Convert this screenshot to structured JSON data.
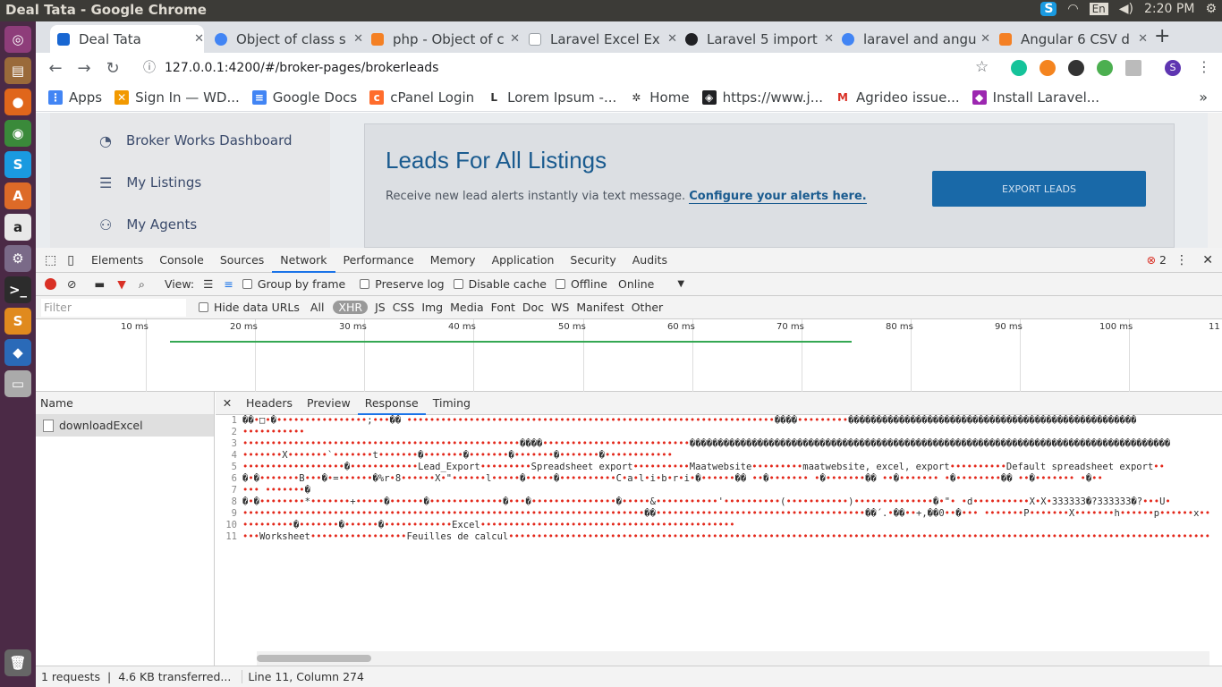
{
  "system": {
    "window_title": "Deal Tata - Google Chrome",
    "keyboard": "En",
    "time": "2:20 PM"
  },
  "tabs": [
    {
      "label": "Deal Tata",
      "color": "#1967d2"
    },
    {
      "label": "Object of class s",
      "color": "#4285f4"
    },
    {
      "label": "php - Object of c",
      "color": "#f48024"
    },
    {
      "label": "Laravel Excel Ex",
      "color": "#9aa0a6"
    },
    {
      "label": "Laravel 5 import",
      "color": "#202124"
    },
    {
      "label": "laravel and angu",
      "color": "#4285f4"
    },
    {
      "label": "Angular 6 CSV d",
      "color": "#f48024"
    }
  ],
  "address": {
    "url": "127.0.0.1:4200/#/broker-pages/brokerleads"
  },
  "bookmarks": [
    {
      "label": "Apps",
      "color": "#4285f4"
    },
    {
      "label": "Sign In — WD...",
      "color": "#f29900"
    },
    {
      "label": "Google Docs",
      "color": "#4285f4"
    },
    {
      "label": "cPanel Login",
      "color": "#ff6c2c"
    },
    {
      "label": "Lorem Ipsum -...",
      "color": "#5f6368"
    },
    {
      "label": "Home",
      "color": "#3c4043"
    },
    {
      "label": "https://www.j...",
      "color": "#202124"
    },
    {
      "label": "Agrideo issue...",
      "color": "#d93025"
    },
    {
      "label": "Install Laravel...",
      "color": "#9c27b0"
    }
  ],
  "page": {
    "sidebar": [
      {
        "label": "Broker Works Dashboard",
        "icon": "dashboard-icon"
      },
      {
        "label": "My Listings",
        "icon": "list-icon"
      },
      {
        "label": "My Agents",
        "icon": "agents-icon"
      }
    ],
    "title": "Leads For All Listings",
    "subtitle": "Receive new lead alerts instantly via text message.",
    "subtitle_link": "Configure your alerts here.",
    "export_button": "EXPORT LEADS"
  },
  "devtools": {
    "tabs": [
      "Elements",
      "Console",
      "Sources",
      "Network",
      "Performance",
      "Memory",
      "Application",
      "Security",
      "Audits"
    ],
    "selected_tab": "Network",
    "error_count": "2",
    "net_options": {
      "view": "View:",
      "group_by_frame": "Group by frame",
      "preserve_log": "Preserve log",
      "disable_cache": "Disable cache",
      "offline": "Offline",
      "throttle": "Online"
    },
    "filter": {
      "placeholder": "Filter",
      "hide_data_urls": "Hide data URLs",
      "types": [
        "All",
        "XHR",
        "JS",
        "CSS",
        "Img",
        "Media",
        "Font",
        "Doc",
        "WS",
        "Manifest",
        "Other"
      ],
      "selected": "XHR"
    },
    "ticks": [
      "10 ms",
      "20 ms",
      "30 ms",
      "40 ms",
      "50 ms",
      "60 ms",
      "70 ms",
      "80 ms",
      "90 ms",
      "100 ms",
      "11"
    ],
    "name_header": "Name",
    "requests": [
      "downloadExcel"
    ],
    "detail_tabs": [
      "Headers",
      "Preview",
      "Response",
      "Timing"
    ],
    "selected_detail": "Response",
    "response_lines": [
      "��•□•�••••••••••••••••;•••��    •••••••••••••••••••••••••••••••••••••••••••••••••••••••••••••••••����•••••••••���������������������������������������������������",
      "•••••••••••",
      "•••••••••••••••••••••••••••••••••••••••••••••••••����••••••••••••••••••••••••••�������������������������������������������������������������������������������������",
      "•••••••X•••••••`•••••••t•••••••�•••••••�•••••••�•••••••�•••••••�••••••••••••",
      "••••••••••••••••••�••••••••••••Lead_Export•••••••••Spreadsheet export••••••••••Maatwebsite•••••••••maatwebsite, excel, export••••••••••Default spreadsheet export••",
      "�•�•••••••B•••�•=••••••�%r•8••••••X•\"••••••l•••••�•••••�••••••••••C•a•l•i•b•r•i•�••••••��  ••�•••••••     •�•••••••��  ••�•••••••   •�••••••••��  ••�•••••••   •�••",
      "••• •••••••�",
      "�•�••••••••*•••••••+•••••�••••••�•••••••••••••�•••�•••••••••••••••�•••••&•••••••••••'••••••••••(•••••••••••)••••••••••••••�•\"•     •d••••••••••X•X•333333�?333333�?•••U•",
      "•••••••••••••••••••••••••••••••••••••••••••••••••••••••••••••••••••••••��•••••••••••••••••••••••••••••••••••••��´.•��••+,��0••�•••   •••••••P•••••••X•••••••h••••••p••••••x•••",
      "•••••••••�•••••••�••••••�••••••••••••Excel•••••••••••••••••••••••••••••••••••••••••••••",
      "•••Worksheet•••••••••••••••••Feuilles de calcul•••••••••••••••••••••••••••••••••••••••••••••••••••••••••••••••••••••••••••••••••••••••••••••••••••••••••••••••••••••••••••••"
    ],
    "status": {
      "requests": "1 requests",
      "transferred": "4.6 KB transferred...",
      "cursor": "Line 11, Column 274"
    }
  }
}
